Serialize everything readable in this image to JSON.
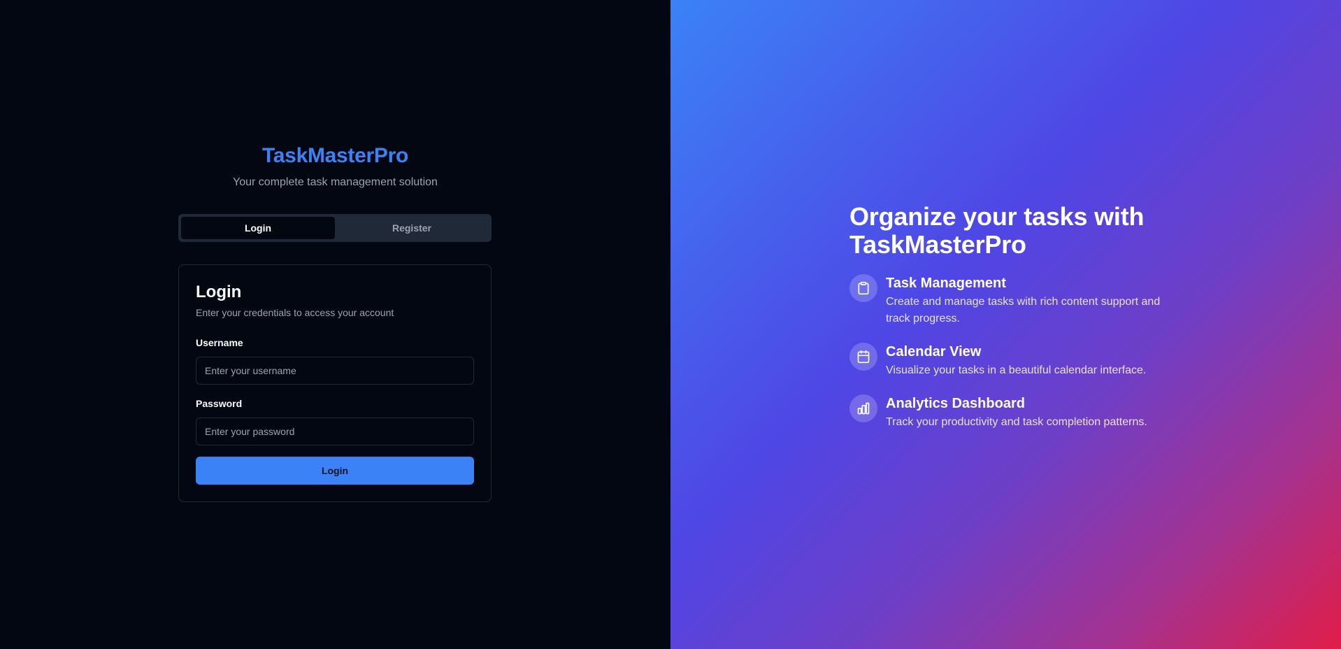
{
  "brand": {
    "name": "TaskMasterPro",
    "tagline": "Your complete task management solution"
  },
  "tabs": [
    {
      "label": "Login",
      "active": true
    },
    {
      "label": "Register",
      "active": false
    }
  ],
  "login_form": {
    "title": "Login",
    "description": "Enter your credentials to access your account",
    "username_label": "Username",
    "username_placeholder": "Enter your username",
    "username_value": "",
    "password_label": "Password",
    "password_placeholder": "Enter your password",
    "password_value": "",
    "submit_label": "Login"
  },
  "hero": {
    "title": "Organize your tasks with TaskMasterPro",
    "features": [
      {
        "icon": "clipboard-icon",
        "title": "Task Management",
        "description": "Create and manage tasks with rich content support and track progress."
      },
      {
        "icon": "calendar-icon",
        "title": "Calendar View",
        "description": "Visualize your tasks in a beautiful calendar interface."
      },
      {
        "icon": "bar-chart-icon",
        "title": "Analytics Dashboard",
        "description": "Track your productivity and task completion patterns."
      }
    ]
  },
  "colors": {
    "accent": "#3b82f6",
    "background": "#030712",
    "gradient_start": "#3b82f6",
    "gradient_mid": "#4f46e5",
    "gradient_end": "#e11d48"
  }
}
